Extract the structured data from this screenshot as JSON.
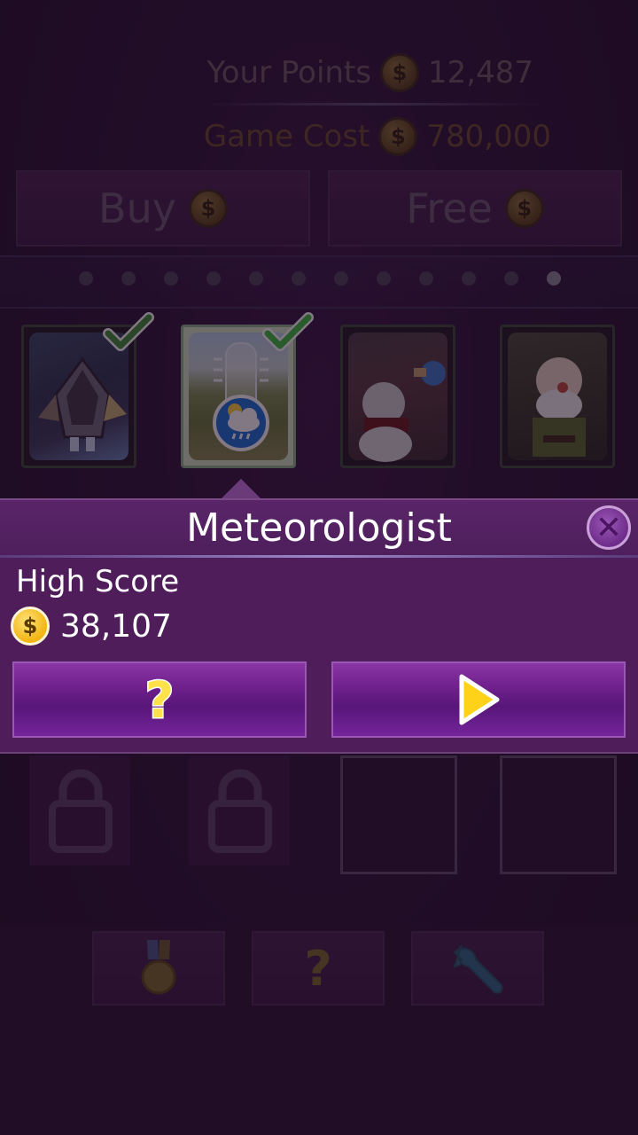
{
  "header": {
    "points_label": "Your Points",
    "points_value": "12,487",
    "cost_label": "Game Cost",
    "cost_value": "780,000",
    "coin_symbol": "$"
  },
  "actions": {
    "buy_label": "Buy",
    "free_label": "Free"
  },
  "pager": {
    "count": 12,
    "active_index": 11
  },
  "cards": [
    {
      "name": "rocket-game",
      "owned": true,
      "selected": false
    },
    {
      "name": "meteorologist",
      "owned": true,
      "selected": true
    },
    {
      "name": "snowman-game",
      "owned": false,
      "selected": false
    },
    {
      "name": "old-man-game",
      "owned": false,
      "selected": false
    }
  ],
  "popup": {
    "title": "Meteorologist",
    "close_symbol": "✕",
    "high_score_label": "High Score",
    "high_score_value": "38,107",
    "help_symbol": "?",
    "play_icon": "play-icon"
  },
  "lower_slots": [
    {
      "state": "locked"
    },
    {
      "state": "locked"
    },
    {
      "state": "empty"
    },
    {
      "state": "empty"
    }
  ],
  "bottom_nav": {
    "medal_icon": "medal-icon",
    "help_symbol": "?",
    "wrench_icon": "wrench-icon"
  },
  "colors": {
    "background": "#2a1230",
    "popup": "#4e1d5a",
    "coin": "#f2b410",
    "check": "#3fbf3f"
  }
}
